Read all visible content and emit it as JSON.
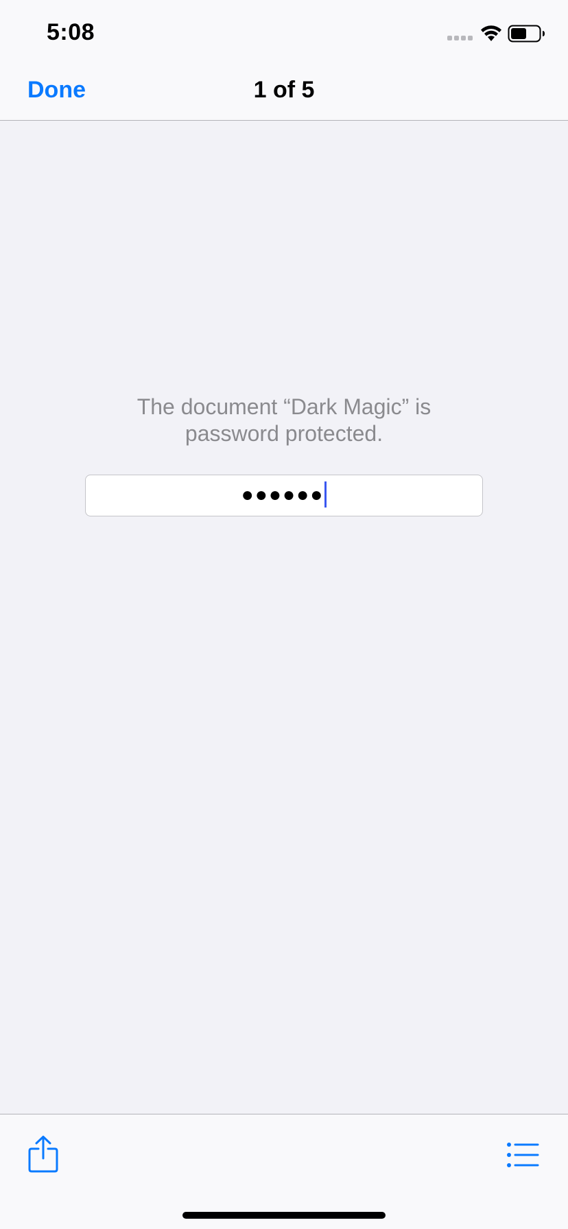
{
  "status_bar": {
    "time": "5:08",
    "icons": [
      "signal-icon",
      "wifi-icon",
      "battery-icon"
    ]
  },
  "nav": {
    "done_label": "Done",
    "title": "1 of 5"
  },
  "content": {
    "message_line1": "The document “Dark Magic” is",
    "message_line2": "password protected.",
    "password_masked": "●●●●●●"
  },
  "toolbar": {
    "icons": [
      "share-icon",
      "list-icon"
    ]
  },
  "colors": {
    "accent": "#0a7aff",
    "caret": "#3a57f0",
    "secondary_text": "#8a8a8e",
    "background": "#f2f2f7"
  }
}
